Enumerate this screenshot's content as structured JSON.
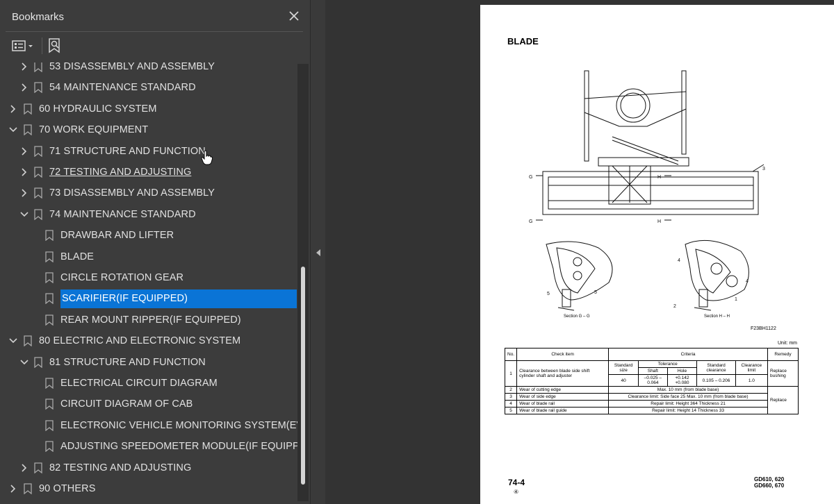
{
  "sidebar": {
    "title": "Bookmarks",
    "close_icon": "close-icon",
    "toolbar": {
      "options_icon": "list-options-icon",
      "find_icon": "find-bookmark-icon"
    },
    "items": [
      {
        "label": "53 DISASSEMBLY AND ASSEMBLY",
        "level": 1,
        "expander": "collapsed"
      },
      {
        "label": "54 MAINTENANCE STANDARD",
        "level": 1,
        "expander": "collapsed"
      },
      {
        "label": "60 HYDRAULIC SYSTEM",
        "level": 0,
        "expander": "collapsed"
      },
      {
        "label": "70 WORK EQUIPMENT",
        "level": 0,
        "expander": "expanded"
      },
      {
        "label": "71 STRUCTURE AND FUNCTION",
        "level": 1,
        "expander": "collapsed"
      },
      {
        "label": "72 TESTING AND ADJUSTING",
        "level": 1,
        "expander": "collapsed",
        "hover": true
      },
      {
        "label": "73 DISASSEMBLY AND ASSEMBLY",
        "level": 1,
        "expander": "collapsed"
      },
      {
        "label": "74 MAINTENANCE STANDARD",
        "level": 1,
        "expander": "expanded"
      },
      {
        "label": "DRAWBAR AND LIFTER",
        "level": 2,
        "expander": "none"
      },
      {
        "label": "BLADE",
        "level": 2,
        "expander": "none"
      },
      {
        "label": "CIRCLE ROTATION GEAR",
        "level": 2,
        "expander": "none"
      },
      {
        "label": "SCARIFIER(IF EQUIPPED)",
        "level": 2,
        "expander": "none",
        "selected": true
      },
      {
        "label": "REAR MOUNT RIPPER(IF EQUIPPED)",
        "level": 2,
        "expander": "none"
      },
      {
        "label": "80 ELECTRIC AND ELECTRONIC SYSTEM",
        "level": 0,
        "expander": "expanded"
      },
      {
        "label": "81 STRUCTURE AND FUNCTION",
        "level": 1,
        "expander": "expanded"
      },
      {
        "label": "ELECTRICAL CIRCUIT DIAGRAM",
        "level": 2,
        "expander": "none"
      },
      {
        "label": "CIRCUIT DIAGRAM OF CAB",
        "level": 2,
        "expander": "none"
      },
      {
        "label": "ELECTRONIC VEHICLE MONITORING SYSTEM(EVMS)",
        "level": 2,
        "expander": "none"
      },
      {
        "label": "ADJUSTING SPEEDOMETER MODULE(IF EQUIPPED)",
        "level": 2,
        "expander": "none"
      },
      {
        "label": "82 TESTING AND ADJUSTING",
        "level": 1,
        "expander": "collapsed"
      },
      {
        "label": "90 OTHERS",
        "level": 0,
        "expander": "collapsed"
      }
    ]
  },
  "page": {
    "title": "BLADE",
    "figure_code": "F23BH1122",
    "section_g": "Section G – G",
    "section_h": "Section H – H",
    "labels": {
      "g": "G",
      "h": "H",
      "n1": "1",
      "n2": "2",
      "n3": "3",
      "n4": "4",
      "n5": "5"
    },
    "unit": "Unit: mm",
    "table": {
      "headers": {
        "no": "No.",
        "check": "Check item",
        "criteria": "Criteria",
        "remedy": "Remedy"
      },
      "sub": {
        "std_size": "Standard size",
        "tolerance": "Tolerance",
        "shaft": "Shaft",
        "hole": "Hole",
        "std_clear": "Standard clearance",
        "clear_limit": "Clearance limit"
      },
      "row1": {
        "no": "1",
        "item": "Clearance between blade side shift cylinder shaft and adjuster",
        "size": "40",
        "shaft": "–0.025 –0.064",
        "hole": "+0.142 +0.080",
        "clear": "0.105 – 0.206",
        "limit": "1.0",
        "remedy": "Replace bushing"
      },
      "row2": {
        "no": "2",
        "item": "Wear of cutting edge",
        "crit": "Max. 10 mm (from blade base)"
      },
      "row3": {
        "no": "3",
        "item": "Wear of side edge",
        "crit_label": "Clearance limit:",
        "crit": "Side face 25  Max. 10 mm (from blade base)"
      },
      "row4": {
        "no": "4",
        "item": "Wear of blade rail",
        "crit_label": "Repair limit:",
        "crit": "Height 364  Thickness 21"
      },
      "row5": {
        "no": "5",
        "item": "Wear of blade rail guide",
        "crit_label": "Repair limit:",
        "crit": "Height 14  Thickness 33"
      },
      "remedy_shared": "Replace"
    },
    "page_number": "74-4",
    "revision": "④",
    "model_line1": "GD610, 620",
    "model_line2": "GD660, 670"
  }
}
